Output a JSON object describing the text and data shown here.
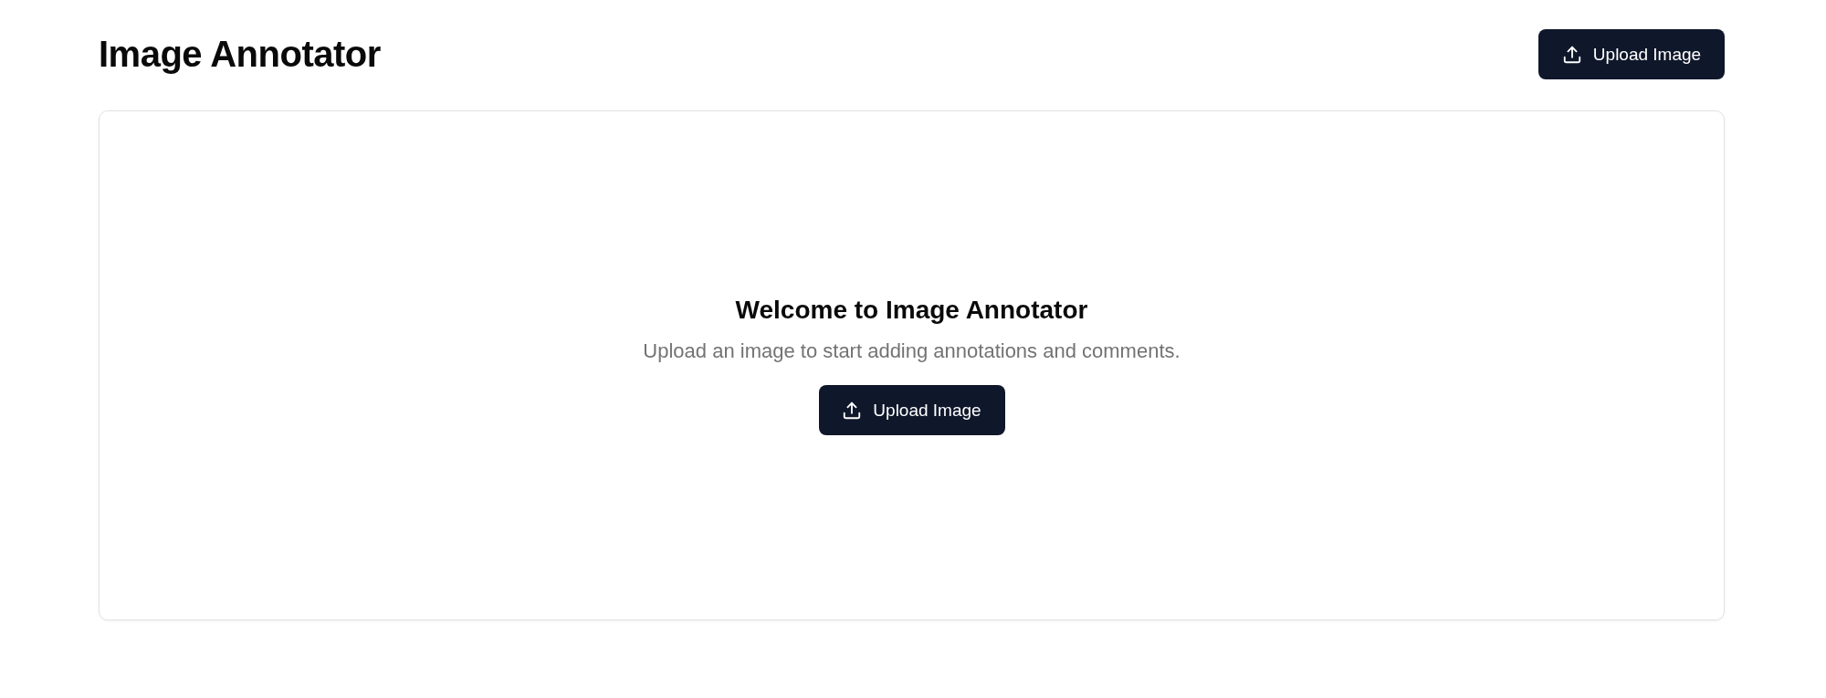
{
  "header": {
    "title": "Image Annotator",
    "upload_button": {
      "label": "Upload Image"
    }
  },
  "empty_state": {
    "heading": "Welcome to Image Annotator",
    "message": "Upload an image to start adding annotations and comments.",
    "upload_button": {
      "label": "Upload Image"
    }
  }
}
